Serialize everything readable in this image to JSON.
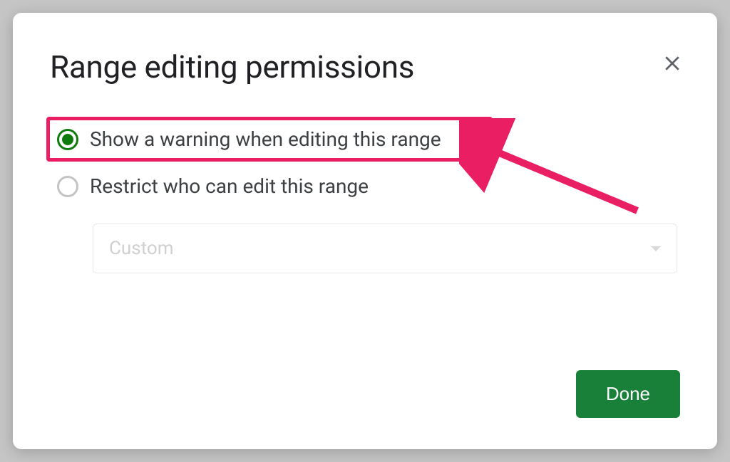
{
  "dialog": {
    "title": "Range editing permissions",
    "options": {
      "warning": {
        "label": "Show a warning when editing this range",
        "selected": true
      },
      "restrict": {
        "label": "Restrict who can edit this range",
        "selected": false
      }
    },
    "dropdown": {
      "value": "Custom",
      "enabled": false
    },
    "doneButton": "Done"
  },
  "colors": {
    "primary": "#188038",
    "radioSelected": "#0f7b0f",
    "highlight": "#e91e63"
  }
}
